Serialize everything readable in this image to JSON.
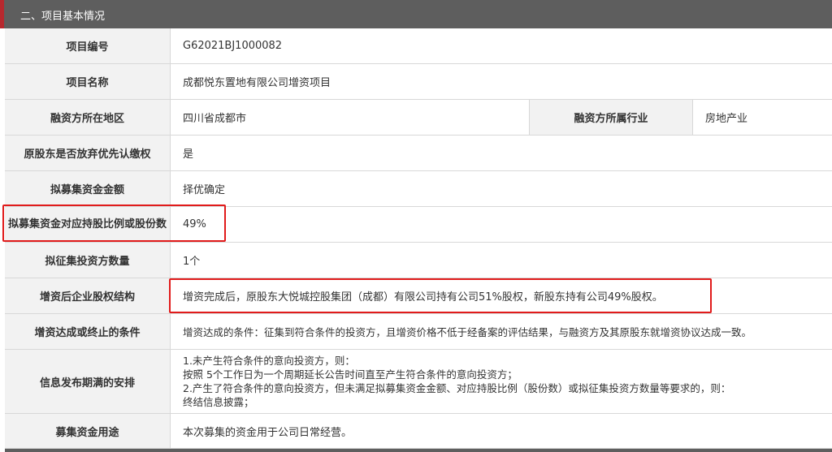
{
  "section": {
    "title": "二、项目基本情况"
  },
  "rows": {
    "project_no": {
      "label": "项目编号",
      "value": "G62021BJ1000082"
    },
    "project_name": {
      "label": "项目名称",
      "value": "成都悦东置地有限公司增资项目"
    },
    "region": {
      "label": "融资方所在地区",
      "value": "四川省成都市",
      "label2": "融资方所属行业",
      "value2": "房地产业"
    },
    "waive_priority": {
      "label": "原股东是否放弃优先认缴权",
      "value": "是"
    },
    "fund_amount": {
      "label": "拟募集资金金额",
      "value": "择优确定"
    },
    "share_ratio": {
      "label": "拟募集资金对应持股比例或股份数",
      "value": "49%"
    },
    "investor_count": {
      "label": "拟征集投资方数量",
      "value": "1个"
    },
    "post_structure": {
      "label": "增资后企业股权结构",
      "value": "增资完成后，原股东大悦城控股集团（成都）有限公司持有公司51%股权，新股东持有公司49%股权。"
    },
    "conditions": {
      "label": "增资达成或终止的条件",
      "value": "增资达成的条件：征集到符合条件的投资方，且增资价格不低于经备案的评估结果，与融资方及其原股东就增资协议达成一致。"
    },
    "expiry_arrangement": {
      "label": "信息发布期满的安排",
      "lines": [
        "1.未产生符合条件的意向投资方，则：",
        "按照 5个工作日为一个周期延长公告时间直至产生符合条件的意向投资方；",
        "2.产生了符合条件的意向投资方，但未满足拟募集资金金额、对应持股比例（股份数）或拟征集投资方数量等要求的，则：",
        "终结信息披露；"
      ]
    },
    "fund_use": {
      "label": "募集资金用途",
      "value": "本次募集的资金用于公司日常经营。"
    }
  }
}
